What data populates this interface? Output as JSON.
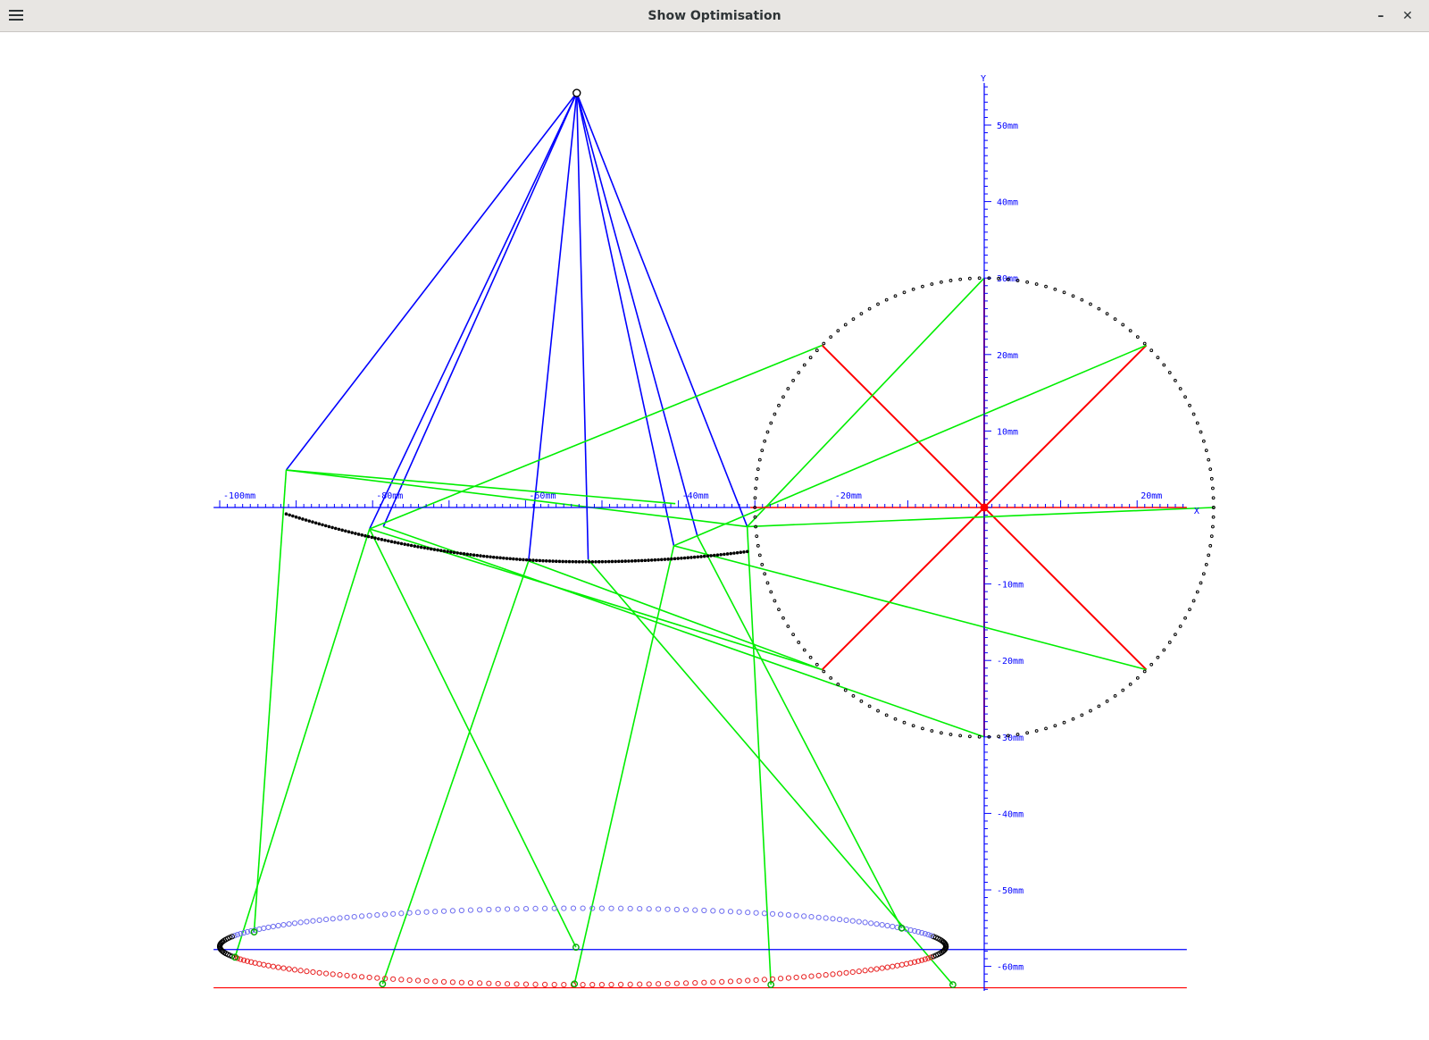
{
  "window": {
    "title": "Show Optimisation",
    "menu_icon": "hamburger-menu-icon",
    "minimize_icon": "minimize-icon",
    "close_icon": "close-icon"
  },
  "axes": {
    "x_title": "X",
    "y_title": "Y",
    "x_ticks": [
      {
        "label": "-100mm",
        "value": -100
      },
      {
        "label": "-80mm",
        "value": -80
      },
      {
        "label": "-60mm",
        "value": -60
      },
      {
        "label": "-40mm",
        "value": -40
      },
      {
        "label": "-20mm",
        "value": -20
      },
      {
        "label": "20mm",
        "value": 20
      }
    ],
    "y_ticks": [
      {
        "label": "50mm",
        "value": 50
      },
      {
        "label": "40mm",
        "value": 40
      },
      {
        "label": "30mm",
        "value": 30
      },
      {
        "label": "20mm",
        "value": 20
      },
      {
        "label": "10mm",
        "value": 10
      },
      {
        "label": "-10mm",
        "value": -10
      },
      {
        "label": "-20mm",
        "value": -20
      },
      {
        "label": "-30mm",
        "value": -30
      },
      {
        "label": "-40mm",
        "value": -40
      },
      {
        "label": "-50mm",
        "value": -50
      },
      {
        "label": "-60mm",
        "value": -60
      }
    ]
  },
  "colors": {
    "axis": "#0000ff",
    "rays_blue": "#0000ff",
    "rays_green": "#00ee00",
    "cross_red": "#ff0000",
    "points": "#000000"
  }
}
